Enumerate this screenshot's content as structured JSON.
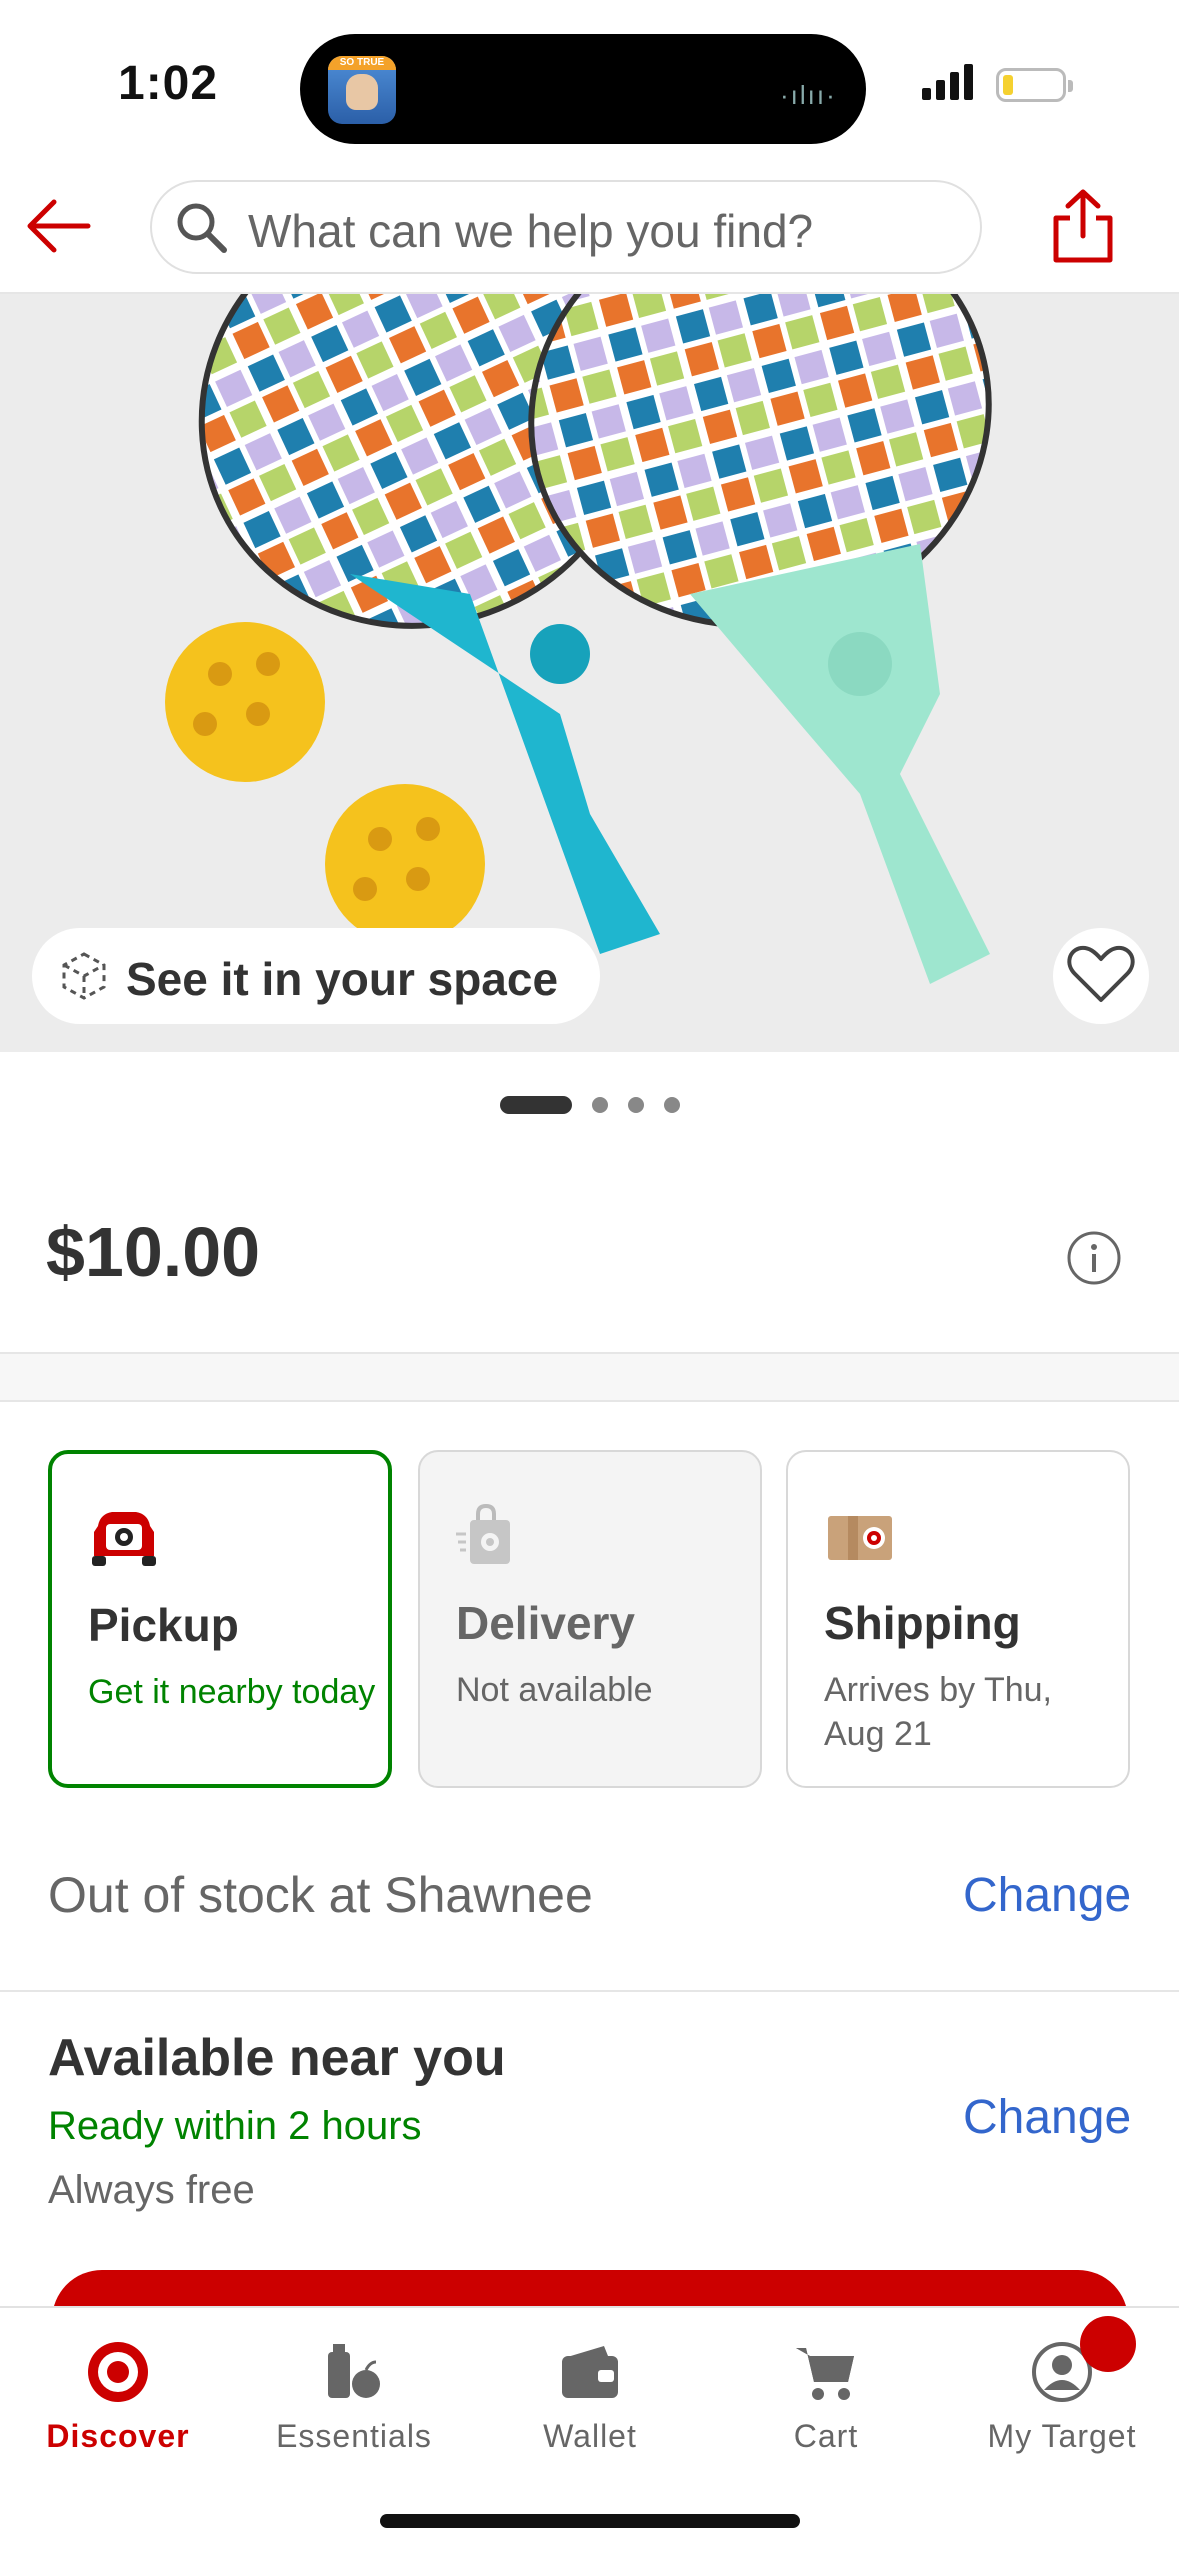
{
  "status_bar": {
    "time": "1:02",
    "island_app_tag": "SO TRUE"
  },
  "header": {
    "search_placeholder": "What can we help you find?"
  },
  "hero": {
    "ar_label": "See it in your space",
    "image_count": 4,
    "active_image": 1
  },
  "product": {
    "price": "$10.00"
  },
  "fulfillment": [
    {
      "id": "pickup",
      "title": "Pickup",
      "subtitle": "Get it nearby today",
      "selected": true,
      "icon": "pickup-car-icon"
    },
    {
      "id": "delivery",
      "title": "Delivery",
      "subtitle": "Not available",
      "selected": false,
      "icon": "delivery-bag-icon"
    },
    {
      "id": "shipping",
      "title": "Shipping",
      "subtitle": "Arrives by Thu, Aug 21",
      "selected": false,
      "icon": "shipping-box-icon"
    }
  ],
  "store": {
    "stock_text": "Out of stock at Shawnee",
    "change_label": "Change"
  },
  "nearby": {
    "title": "Available near you",
    "ready": "Ready within 2 hours",
    "free": "Always free",
    "change_label": "Change"
  },
  "bottom_nav": [
    {
      "label": "Discover",
      "icon": "target-bullseye-icon",
      "active": true
    },
    {
      "label": "Essentials",
      "icon": "essentials-icon",
      "active": false
    },
    {
      "label": "Wallet",
      "icon": "wallet-icon",
      "active": false
    },
    {
      "label": "Cart",
      "icon": "cart-icon",
      "active": false
    },
    {
      "label": "My Target",
      "icon": "account-icon",
      "active": false
    }
  ],
  "colors": {
    "brand_red": "#cc0000",
    "link_blue": "#3366cc",
    "success_green": "#008300"
  }
}
